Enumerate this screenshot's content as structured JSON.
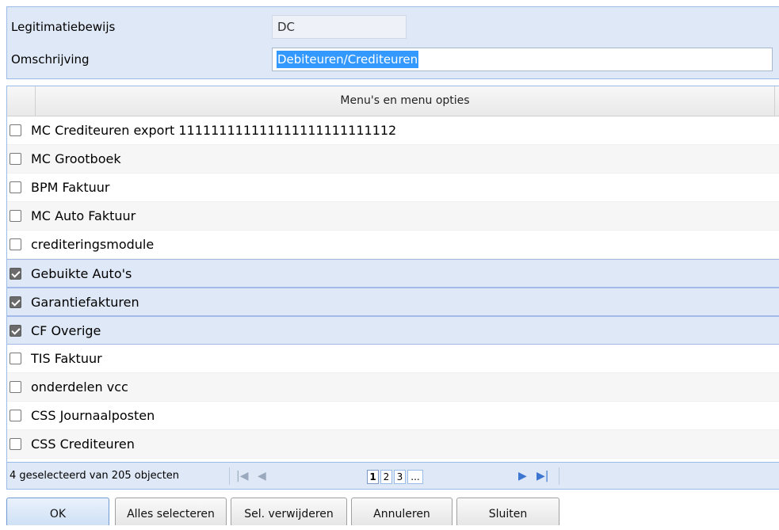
{
  "form": {
    "legitimatie_label": "Legitimatiebewijs",
    "legitimatie_value": "DC",
    "omschrijving_label": "Omschrijving",
    "omschrijving_value": "Debiteuren/Crediteuren"
  },
  "grid": {
    "column_header": "Menu's en menu opties",
    "rows": [
      {
        "label": "MC Crediteuren export 111111111111111111111111112",
        "checked": false
      },
      {
        "label": "MC Grootboek",
        "checked": false
      },
      {
        "label": "BPM Faktuur",
        "checked": false
      },
      {
        "label": "MC Auto Faktuur",
        "checked": false
      },
      {
        "label": "crediteringsmodule",
        "checked": false
      },
      {
        "label": "Gebuikte Auto's",
        "checked": true
      },
      {
        "label": "Garantiefakturen",
        "checked": true
      },
      {
        "label": "CF Overige",
        "checked": true
      },
      {
        "label": "TIS Faktuur",
        "checked": false
      },
      {
        "label": "onderdelen vcc",
        "checked": false
      },
      {
        "label": "CSS Journaalposten",
        "checked": false
      },
      {
        "label": "CSS Crediteuren",
        "checked": false
      }
    ]
  },
  "pager": {
    "status": "4 geselecteerd van 205 objecten",
    "pages": [
      "1",
      "2",
      "3",
      "..."
    ],
    "current_page": "1",
    "first_icon": "first-page-icon",
    "prev_icon": "previous-page-icon",
    "next_icon": "next-page-icon",
    "last_icon": "last-page-icon"
  },
  "buttons": {
    "ok": "OK",
    "select_all": "Alles selecteren",
    "remove_selection": "Sel. verwijderen",
    "cancel": "Annuleren",
    "close": "Sluiten"
  },
  "colors": {
    "panel_bg": "#dfe8f6",
    "panel_border": "#99bbe8",
    "selection_highlight": "#3399ff",
    "nav_active": "#3c76d1"
  }
}
